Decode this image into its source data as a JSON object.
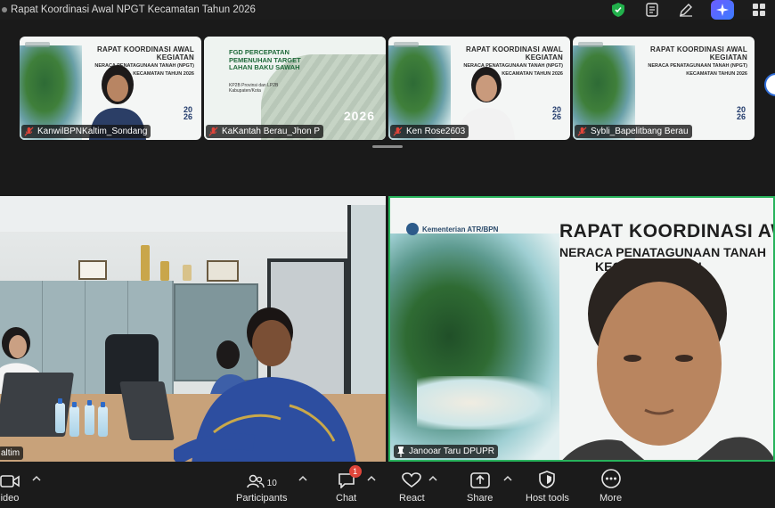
{
  "window": {
    "title": "Rapat Koordinasi Awal NPGT Kecamatan Tahun 2026"
  },
  "slide": {
    "title": "RAPAT KOORDINASI AWAL KEGIATAN",
    "subtitle_line1": "NERACA PENATAGUNAAN TANAH (NPGT)",
    "subtitle_line2": "KECAMATAN TAHUN 2026",
    "year_top": "20",
    "year_bottom": "26",
    "big_title": "RAPAT KOORDINASI AWAL K",
    "big_sub1": "NERACA PENATAGUNAAN TANAH",
    "big_sub2": "KECAMATAN TAH",
    "logo_text": "Kementerian ATR/BPN"
  },
  "fgd_slide": {
    "title": "FGD PERCEPATAN PEMENUHAN TARGET LAHAN BAKU SAWAH",
    "subtitle": "KP2B Provinsi dan LP2B Kabupaten/Kota",
    "year": "2026"
  },
  "participants": [
    {
      "name": "KanwilBPNKaltim_Sondang"
    },
    {
      "name": "KaKantah Berau_Jhon P"
    },
    {
      "name": "Ken Rose2603"
    },
    {
      "name": "Sybli_Bapelitbang Berau"
    }
  ],
  "main_tiles": {
    "left_name": "altim",
    "right_name": "Janooar Taru DPUPR"
  },
  "toolbar": {
    "video_label": "ideo",
    "participants_label": "Participants",
    "participants_count": "10",
    "chat_label": "Chat",
    "chat_badge": "1",
    "react_label": "React",
    "share_label": "Share",
    "host_tools_label": "Host tools",
    "more_label": "More"
  },
  "colors": {
    "active_speaker": "#27b35b",
    "badge": "#e0453a",
    "mic_muted": "#e0453a",
    "ai_gradient_start": "#6c5cff",
    "ai_gradient_end": "#3b7bff",
    "shield": "#22b14c"
  }
}
